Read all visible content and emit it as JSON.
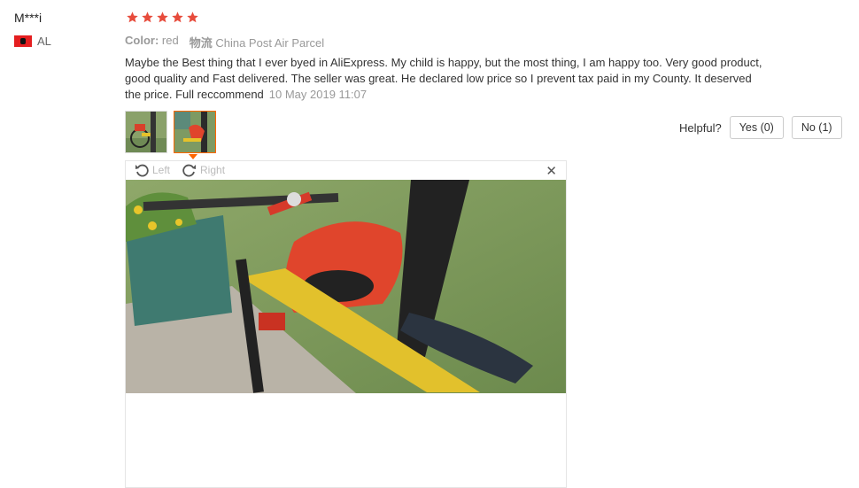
{
  "user": {
    "name": "M***i",
    "country": "AL"
  },
  "rating": {
    "stars": 5,
    "max": 5,
    "color": "#e74c3c"
  },
  "meta": {
    "color_label": "Color:",
    "color_value": "red",
    "shipping_label": "物流",
    "shipping_value": "China Post Air Parcel"
  },
  "review": {
    "text": "Maybe the Best thing that I ever byed in AliExpress. My child is happy, but the most thing, I am happy too. Very good product, good quality and Fast delivered. The seller was great. He declared low price so I prevent tax paid in my County. It deserved the price. Full reccommend",
    "date": "10 May 2019 11:07"
  },
  "helpful": {
    "label": "Helpful?",
    "yes": "Yes (0)",
    "no": "No (1)"
  },
  "viewer": {
    "rotate_left": "Left",
    "rotate_right": "Right",
    "close": "✕"
  },
  "colors": {
    "accent": "#ff6600",
    "star": "#e74c3c"
  }
}
